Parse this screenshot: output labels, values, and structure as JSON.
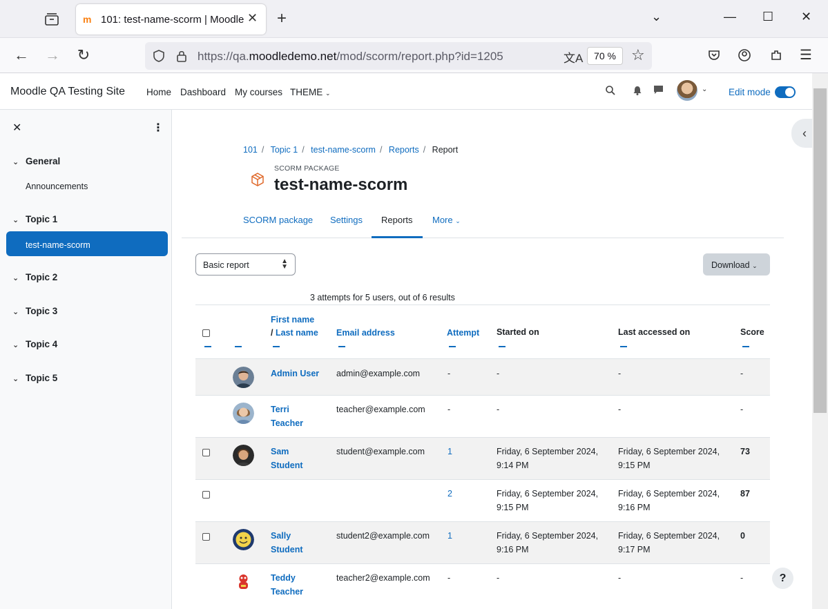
{
  "browser": {
    "tab_title": "101: test-name-scorm | Moodle",
    "url_prefix": "https://qa.",
    "url_domain": "moodledemo.net",
    "url_path": "/mod/scorm/report.php?id=1205",
    "zoom": "70 %"
  },
  "header": {
    "site_name": "Moodle QA Testing Site",
    "nav": [
      "Home",
      "Dashboard",
      "My courses",
      "THEME"
    ],
    "edit_mode": "Edit mode"
  },
  "sidebar": {
    "sections": [
      {
        "label": "General",
        "items": [
          "Announcements"
        ]
      },
      {
        "label": "Topic 1",
        "items": [
          "test-name-scorm"
        ]
      },
      {
        "label": "Topic 2",
        "items": []
      },
      {
        "label": "Topic 3",
        "items": []
      },
      {
        "label": "Topic 4",
        "items": []
      },
      {
        "label": "Topic 5",
        "items": []
      }
    ]
  },
  "breadcrumb": [
    "101",
    "Topic 1",
    "test-name-scorm",
    "Reports",
    "Report"
  ],
  "activity": {
    "type": "SCORM PACKAGE",
    "title": "test-name-scorm"
  },
  "secondary_nav": [
    "SCORM package",
    "Settings",
    "Reports",
    "More"
  ],
  "report_select": "Basic report",
  "download_label": "Download",
  "summary": "3 attempts for 5 users, out of 6 results",
  "table": {
    "headers": {
      "first_name": "First name",
      "slash": "/",
      "last_name": "Last name",
      "email": "Email address",
      "attempt": "Attempt",
      "started": "Started on",
      "last_accessed": "Last accessed on",
      "score": "Score"
    },
    "rows": [
      {
        "first": "Admin User",
        "last": "",
        "email": "admin@example.com",
        "attempt": "-",
        "started1": "-",
        "started2": "",
        "accessed1": "-",
        "accessed2": "",
        "score": "-"
      },
      {
        "first": "Terri",
        "last": "Teacher",
        "email": "teacher@example.com",
        "attempt": "-",
        "started1": "-",
        "started2": "",
        "accessed1": "-",
        "accessed2": "",
        "score": "-"
      },
      {
        "first": "Sam",
        "last": "Student",
        "email": "student@example.com",
        "attempt": "1",
        "started1": "Friday, 6 September 2024,",
        "started2": "9:14 PM",
        "accessed1": "Friday, 6 September 2024,",
        "accessed2": "9:15 PM",
        "score": "73"
      },
      {
        "first": "",
        "last": "",
        "email": "",
        "attempt": "2",
        "started1": "Friday, 6 September 2024,",
        "started2": "9:15 PM",
        "accessed1": "Friday, 6 September 2024,",
        "accessed2": "9:16 PM",
        "score": "87"
      },
      {
        "first": "Sally",
        "last": "Student",
        "email": "student2@example.com",
        "attempt": "1",
        "started1": "Friday, 6 September 2024,",
        "started2": "9:16 PM",
        "accessed1": "Friday, 6 September 2024,",
        "accessed2": "9:17 PM",
        "score": "0"
      },
      {
        "first": "Teddy",
        "last": "Teacher",
        "email": "teacher2@example.com",
        "attempt": "-",
        "started1": "-",
        "started2": "",
        "accessed1": "-",
        "accessed2": "",
        "score": "-"
      }
    ]
  },
  "help_label": "?",
  "colors": {
    "accent": "#0f6cbf",
    "moodle_orange": "#f98012"
  }
}
